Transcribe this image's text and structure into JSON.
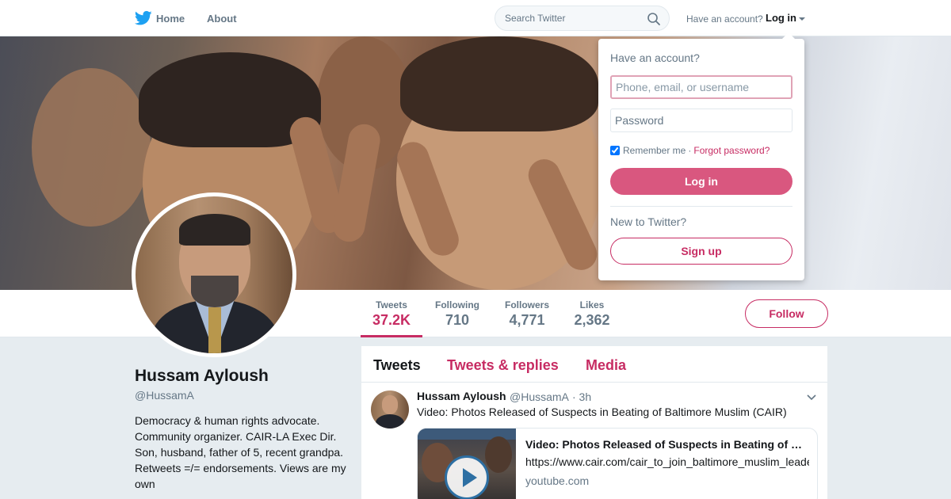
{
  "nav": {
    "logo_icon": "twitter-bird-icon",
    "home_label": "Home",
    "about_label": "About",
    "search_placeholder": "Search Twitter",
    "have_account_text": "Have an account?",
    "login_label": "Log in",
    "brand_color": "#1da1f2"
  },
  "profile": {
    "name": "Hussam Ayloush",
    "handle": "@HussamA",
    "bio": "Democracy & human rights advocate. Community organizer. CAIR-LA Exec Dir. Son, husband, father of 5, recent grandpa. Retweets =/= endorsements. Views are my own",
    "accent_color": "#c72c63"
  },
  "stats": [
    {
      "label": "Tweets",
      "value": "37.2K"
    },
    {
      "label": "Following",
      "value": "710"
    },
    {
      "label": "Followers",
      "value": "4,771"
    },
    {
      "label": "Likes",
      "value": "2,362"
    }
  ],
  "follow_label": "Follow",
  "timeline": {
    "tabs": [
      "Tweets",
      "Tweets & replies",
      "Media"
    ],
    "tweet": {
      "name": "Hussam Ayloush",
      "handle": "@HussamA",
      "time": "· 3h",
      "text": "Video: Photos Released of Suspects in Beating of Baltimore Muslim (CAIR)",
      "card": {
        "title": "Video: Photos Released of Suspects in Beating of Baltimore Muslim (CAIR)",
        "url": "https://www.cair.com/cair_to_join_baltimore_muslim_leaders",
        "domain": "youtube.com"
      }
    }
  },
  "login_dropdown": {
    "heading": "Have an account?",
    "username_placeholder": "Phone, email, or username",
    "password_placeholder": "Password",
    "remember_label": "Remember me",
    "separator": "·",
    "forgot_label": "Forgot password?",
    "login_button": "Log in",
    "new_text": "New to Twitter?",
    "signup_button": "Sign up"
  }
}
